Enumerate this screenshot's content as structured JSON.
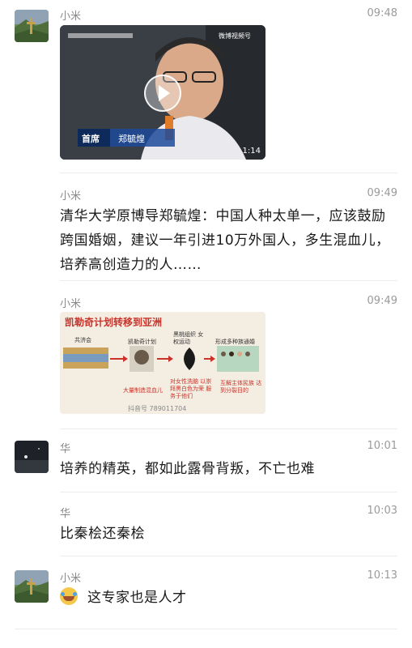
{
  "messages": [
    {
      "name": "小米",
      "time": "09:48",
      "type": "video",
      "video": {
        "duration": "1:14",
        "watermark": "微博视频号",
        "badge": "首席",
        "caption": "郑毓煌"
      }
    },
    {
      "name": "小米",
      "time": "09:49",
      "type": "text",
      "text": "清华大学原博导郑毓煌：中国人种太单一，应该鼓励跨国婚姻，建议一年引进10万外国人，多生混血儿，培养高创造力的人……"
    },
    {
      "name": "小米",
      "time": "09:49",
      "type": "image",
      "image": {
        "title": "凯勒奇计划转移到亚洲",
        "label1": "共济会",
        "label2": "凯勒奇计划",
        "label3": "黑桃组织 女权运动",
        "label4": "形成多种族通婚",
        "note1": "大量制造混血儿",
        "note2": "对女性洗脑 以崇拜黑白色为荣 服务于他们",
        "note3": "互解主体民族 达到分裂目的",
        "footer": "抖音号 789011704"
      }
    },
    {
      "name": "华",
      "time": "10:01",
      "type": "text",
      "text": "培养的精英，都如此露骨背叛，不亡也难"
    },
    {
      "name": "华",
      "time": "10:03",
      "type": "text",
      "text": "比秦桧还秦桧"
    },
    {
      "name": "小米",
      "time": "10:13",
      "type": "text",
      "emoji": "laughing-crying-emoji",
      "text": "这专家也是人才"
    }
  ]
}
